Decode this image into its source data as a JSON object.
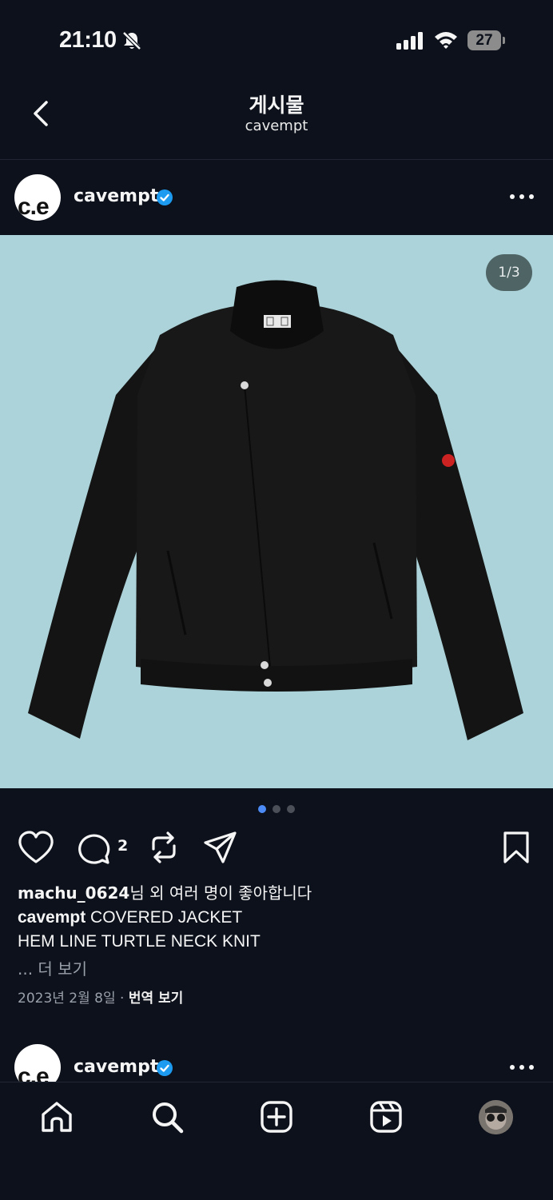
{
  "status_bar": {
    "time": "21:10",
    "battery_level": "27"
  },
  "header": {
    "title": "게시물",
    "subtitle": "cavempt"
  },
  "post": {
    "avatar_text": "c.e",
    "username": "cavempt",
    "image_counter": "1/3",
    "comment_count": "2",
    "likes": {
      "user": "machu_0624",
      "suffix": "님 외 여러 명이 좋아합니다"
    },
    "caption": {
      "username": "cavempt",
      "line1": " COVERED JACKET",
      "line2": "HEM LINE TURTLE NECK KNIT"
    },
    "more_label": "... 더 보기",
    "date": "2023년 2월 8일",
    "separator": "·",
    "translate_label": "번역 보기"
  },
  "next_post": {
    "avatar_text": "c.e",
    "username": "cavempt"
  },
  "colors": {
    "background": "#0c111b",
    "image_bg": "#abd3d9",
    "verified": "#1d9bf0",
    "active_dot": "#4c8bf5"
  },
  "icons": [
    "bell-off-icon",
    "signal-icon",
    "wifi-icon",
    "back-chevron-icon",
    "verified-badge-icon",
    "more-horizontal-icon",
    "heart-icon",
    "comment-icon",
    "repost-icon",
    "share-icon",
    "bookmark-icon",
    "home-icon",
    "search-icon",
    "create-icon",
    "reels-icon"
  ]
}
